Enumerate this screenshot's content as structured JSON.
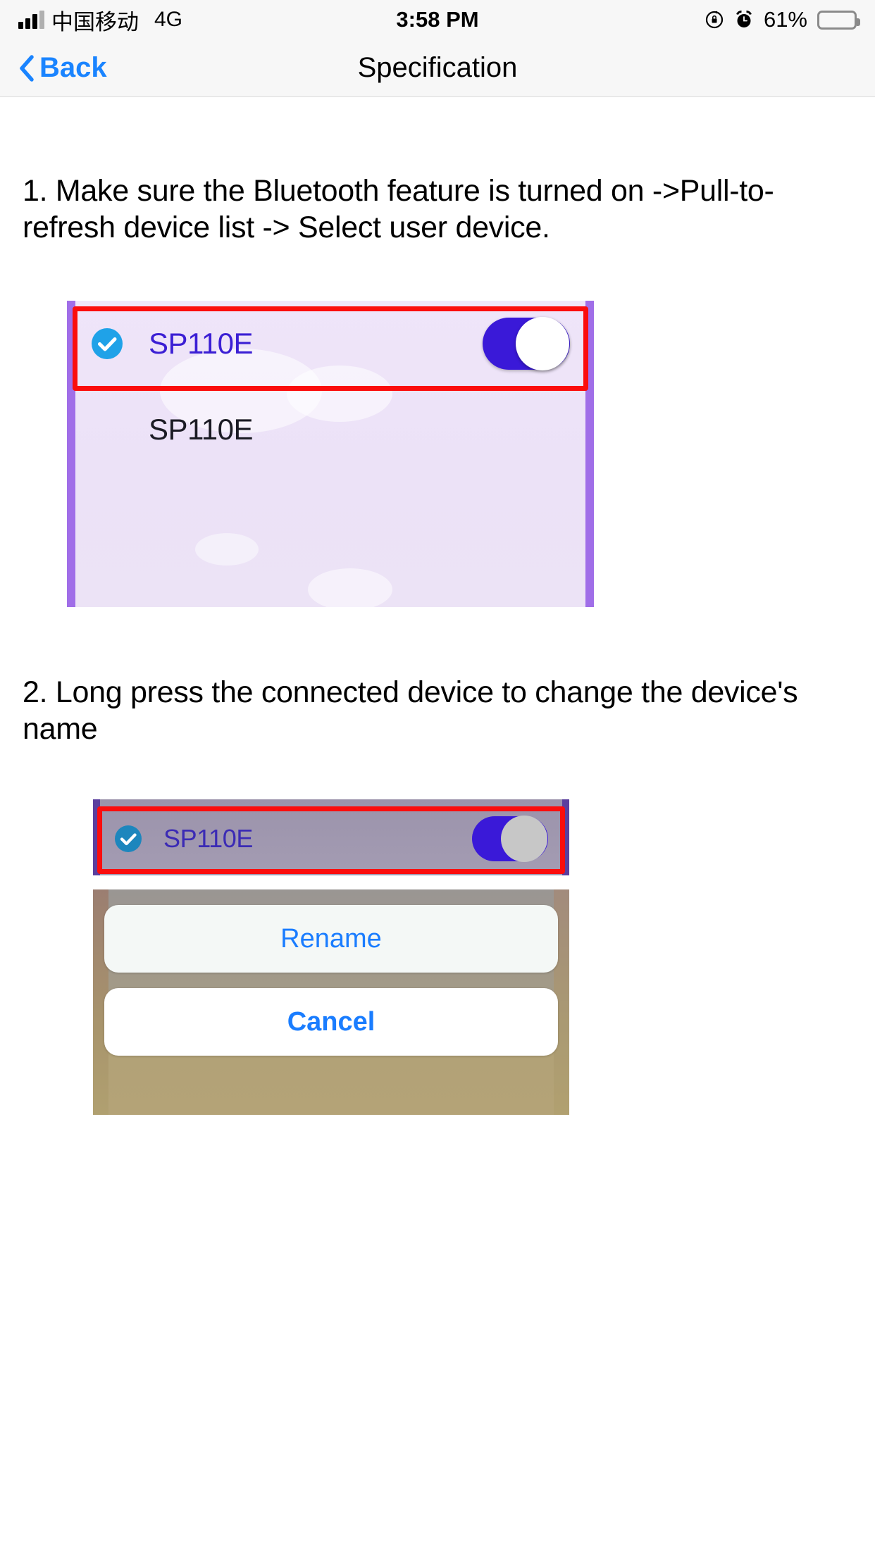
{
  "status_bar": {
    "carrier": "中国移动",
    "network": "4G",
    "time": "3:58 PM",
    "battery_percent": "61%",
    "battery_level": 61,
    "icons": [
      "signal-bars-icon",
      "rotation-lock-icon",
      "alarm-clock-icon",
      "battery-icon"
    ]
  },
  "nav_bar": {
    "back_label": "Back",
    "title": "Specification"
  },
  "steps": [
    {
      "text": "1. Make sure the Bluetooth feature is turned on ->Pull-to-refresh device list -> Select user device."
    },
    {
      "text": "2. Long press the connected device to change the device's name"
    }
  ],
  "figure1": {
    "rows": [
      {
        "name": "SP110E",
        "selected": true,
        "toggle_on": true
      },
      {
        "name": "SP110E",
        "selected": false,
        "toggle_on": false
      }
    ],
    "highlight_color": "#fb0d0d",
    "panel_border_color": "#a06ee8",
    "panel_bg_color": "#ece2f7",
    "selected_text_color": "#3b1fd4",
    "toggle_on_color": "#3a19d8",
    "check_color": "#1fa2e8"
  },
  "figure2": {
    "device_row": {
      "name": "SP110E",
      "selected": true,
      "toggle_on": true
    },
    "highlight_color": "#fb0d0d",
    "actions": [
      {
        "label": "Rename",
        "style": "default"
      },
      {
        "label": "Cancel",
        "style": "bold"
      }
    ],
    "action_text_color": "#1a7dff"
  },
  "colors": {
    "accent_blue": "#1a84ff",
    "nav_bg": "#f7f7f7",
    "page_bg": "#ffffff"
  }
}
